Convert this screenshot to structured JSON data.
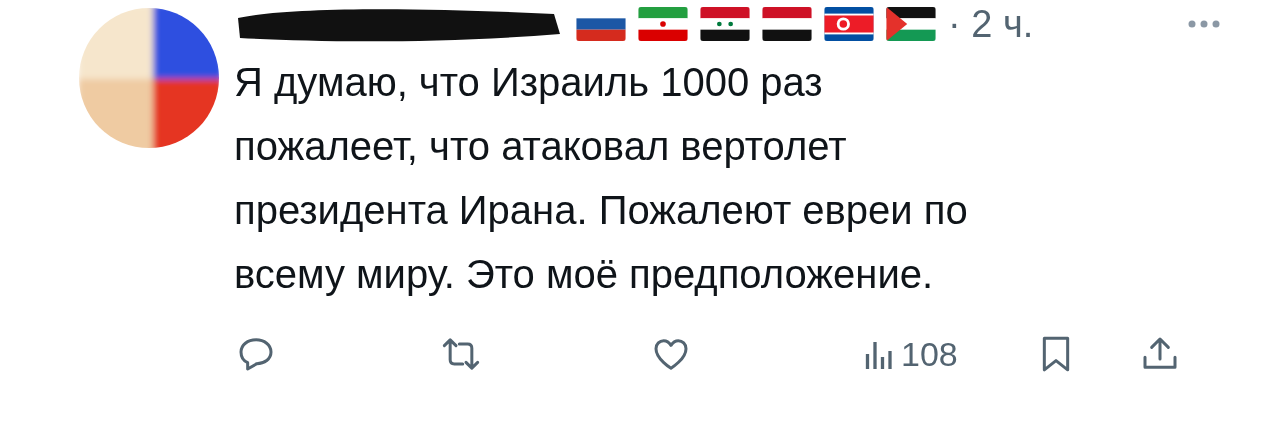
{
  "post": {
    "time": "· 2 ч.",
    "text": "Я думаю, что Израиль 1000 раз\nпожалеет, что атаковал вертолет\nпрезидента Ирана. Пожалеют евреи по\nвсему миру. Это моё предположение.",
    "views": "108"
  }
}
